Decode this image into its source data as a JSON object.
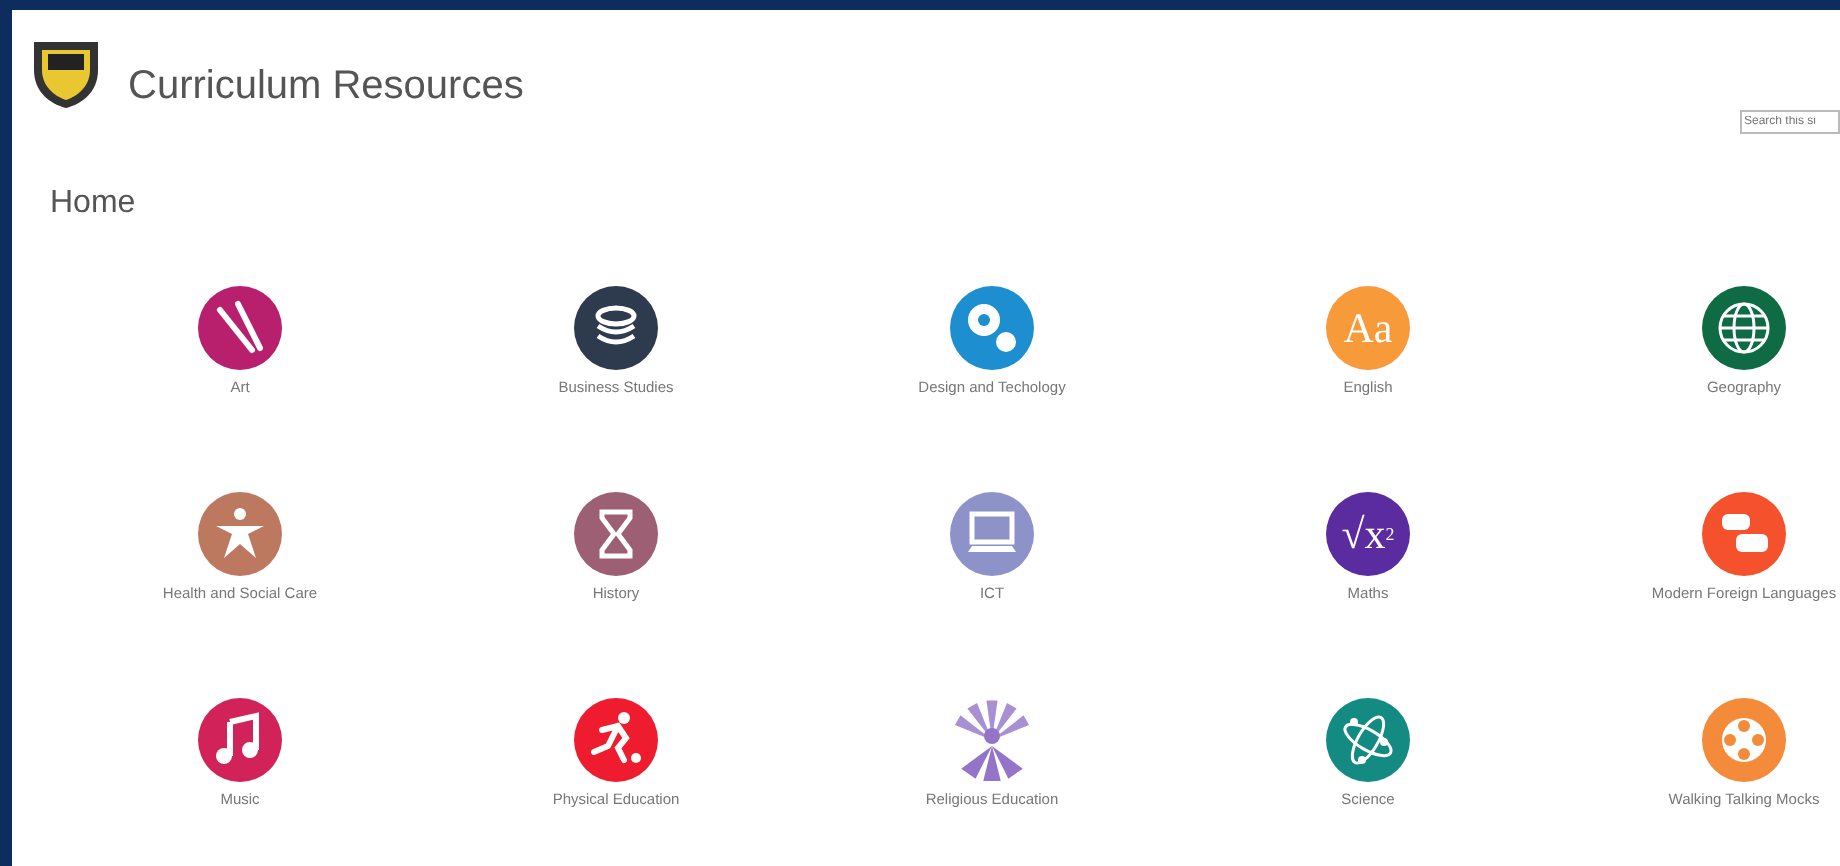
{
  "header": {
    "title": "Curriculum Resources",
    "search": {
      "placeholder": "Search this si"
    }
  },
  "page": {
    "title": "Home"
  },
  "tiles": [
    {
      "label": "Art",
      "kind": "brushes",
      "color": "#b8206e"
    },
    {
      "label": "Business Studies",
      "kind": "coins",
      "color": "#2e3a4e"
    },
    {
      "label": "Design and Techology",
      "kind": "gears",
      "color": "#1d8fd0"
    },
    {
      "label": "English",
      "kind": "letters",
      "color": "#f79a3a",
      "icon_text": "Aa"
    },
    {
      "label": "Geography",
      "kind": "globe",
      "color": "#0f6b44"
    },
    {
      "label": "Health and Social Care",
      "kind": "person",
      "color": "#bd7860"
    },
    {
      "label": "History",
      "kind": "hourglass",
      "color": "#9c5f73"
    },
    {
      "label": "ICT",
      "kind": "monitor",
      "color": "#8d93c8"
    },
    {
      "label": "Maths",
      "kind": "letters",
      "color": "#5a2ca0",
      "icon_text": "√x$^{2}$"
    },
    {
      "label": "Modern Foreign Languages",
      "kind": "speech",
      "color": "#f5512d"
    },
    {
      "label": "Music",
      "kind": "note",
      "color": "#d1235a"
    },
    {
      "label": "Physical Education",
      "kind": "runner",
      "color": "#ee1c2e"
    },
    {
      "label": "Religious Education",
      "kind": "rays",
      "color": "#9474c8"
    },
    {
      "label": "Science",
      "kind": "atom",
      "color": "#148b82"
    },
    {
      "label": "Walking Talking Mocks",
      "kind": "reel",
      "color": "#f38b3a"
    }
  ]
}
